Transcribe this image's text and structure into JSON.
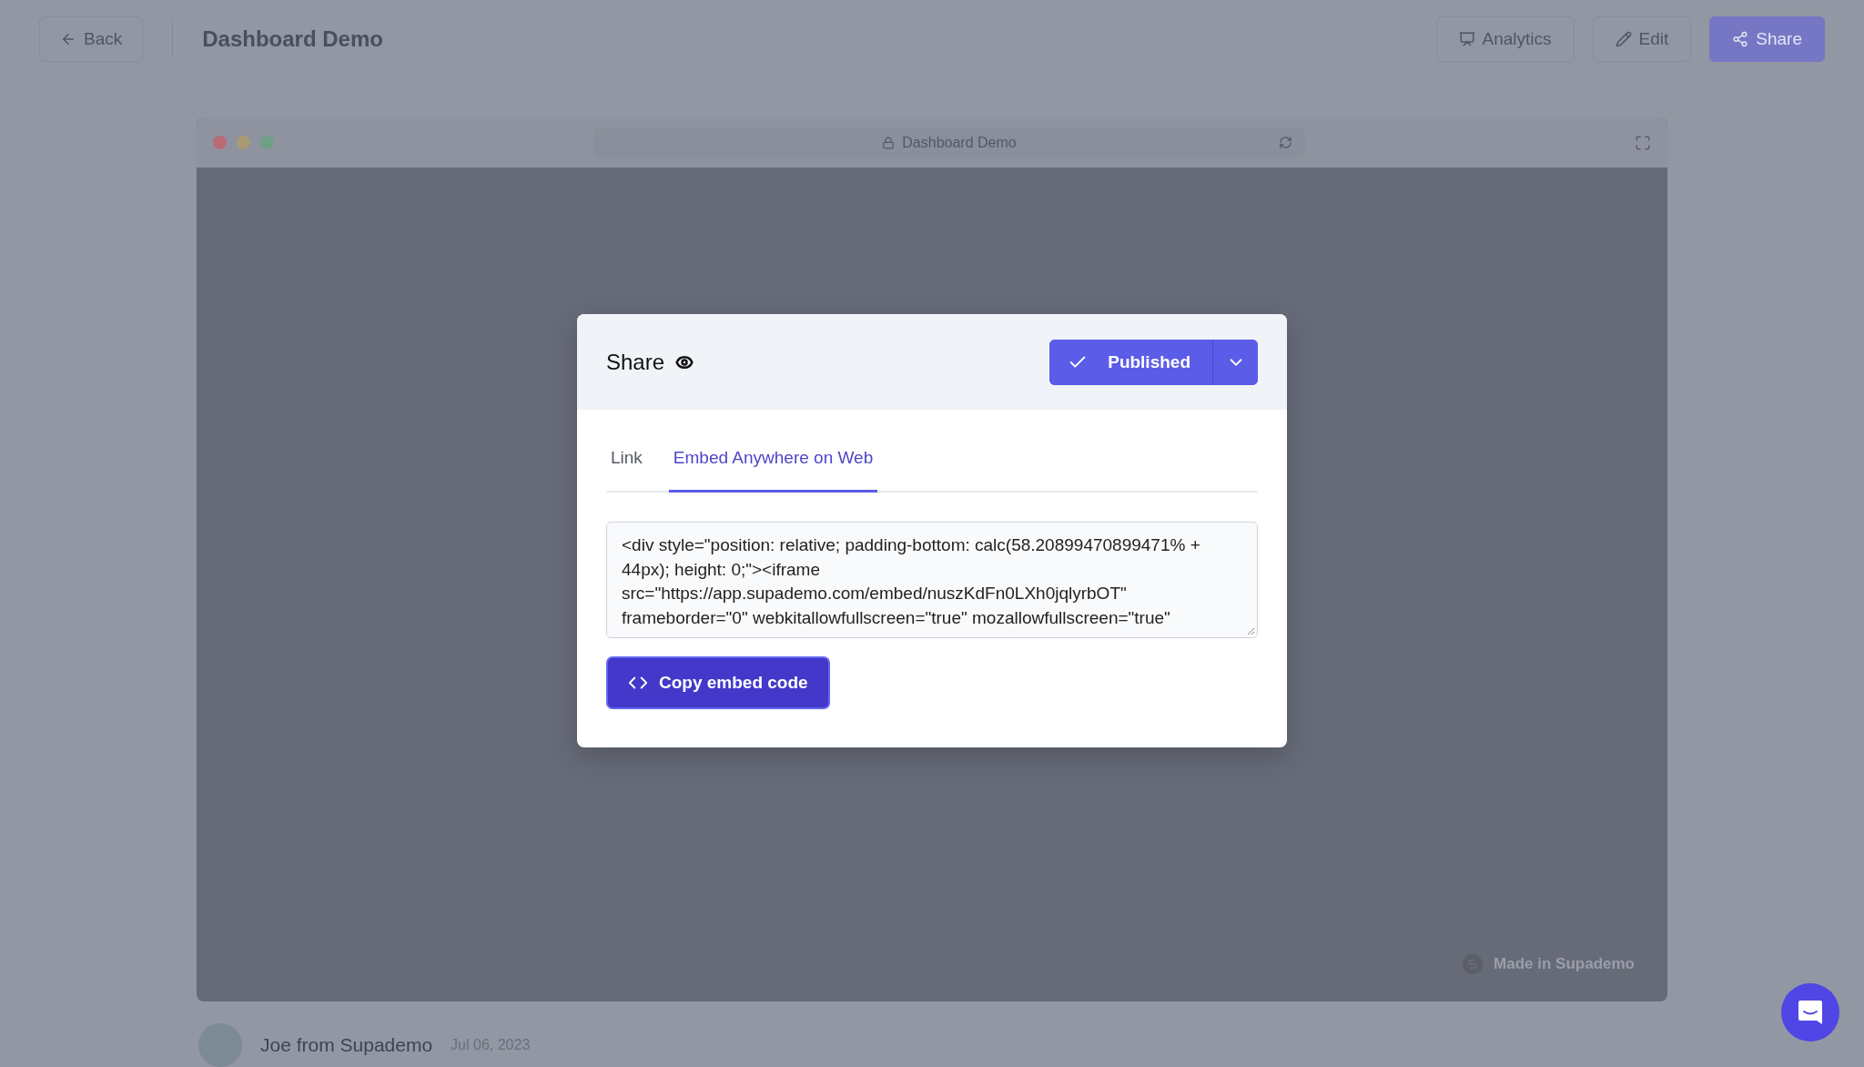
{
  "top_bar": {
    "back_button": "Back",
    "title": "Dashboard Demo",
    "buttons": [
      {
        "label": "Analytics",
        "kind": "analytics"
      },
      {
        "label": "Edit",
        "kind": "edit"
      },
      {
        "label": "Share",
        "kind": "share"
      }
    ]
  },
  "demo_window": {
    "address": "Dashboard Demo",
    "badge": "Made in Supademo"
  },
  "modal": {
    "title": "Share",
    "status_button": "Published",
    "tabs": [
      {
        "label": "Link",
        "selected": false
      },
      {
        "label": "Embed Anywhere on Web",
        "selected": true
      }
    ],
    "embed_code": "<div style=\"position: relative; padding-bottom: calc(58.20899470899471% + 44px); height: 0;\"><iframe src=\"https://app.supademo.com/embed/nuszKdFn0LXh0jqlyrbOT\" frameborder=\"0\" webkitallowfullscreen=\"true\" mozallowfullscreen=\"true\"",
    "copy_button": "Copy embed code"
  },
  "author": {
    "name": "Joe from Supademo",
    "date": "Jul 06, 2023"
  }
}
